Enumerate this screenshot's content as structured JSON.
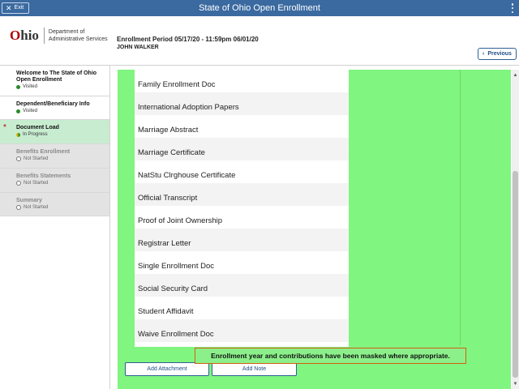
{
  "topbar": {
    "exit_label": "Exit",
    "title": "State of Ohio Open Enrollment"
  },
  "header": {
    "logo_word": "Ohio",
    "logo_dept_line1": "Department of",
    "logo_dept_line2": "Administrative Services",
    "period_text": "Enrollment Period 05/17/20   - 11:59pm 06/01/20",
    "person_name": "JOHN WALKER",
    "previous_label": "Previous"
  },
  "sidebar": {
    "steps": [
      {
        "name": "Welcome to The State of Ohio Open Enrollment",
        "status": "Visited",
        "state": "visited"
      },
      {
        "name": "Dependent/Beneficiary Info",
        "status": "Visited",
        "state": "visited"
      },
      {
        "name": "Document Load",
        "status": "In Progress",
        "state": "current"
      },
      {
        "name": "Benefits Enrollment",
        "status": "Not Started",
        "state": "not-started"
      },
      {
        "name": "Benefits Statements",
        "status": "Not Started",
        "state": "not-started"
      },
      {
        "name": "Summary",
        "status": "Not Started",
        "state": "not-started"
      }
    ]
  },
  "documents": [
    "Family Enrollment Doc",
    "International Adoption Papers",
    "Marriage Abstract",
    "Marriage Certificate",
    "NatStu Clrghouse Certificate",
    "Official Transcript",
    "Proof of Joint Ownership",
    "Registrar Letter",
    "Single Enrollment Doc",
    "Social Security Card",
    "Student Affidavit",
    "Waive Enrollment Doc"
  ],
  "actions": {
    "add_attachment_label": "Add Attachment",
    "add_note_label": "Add Note"
  },
  "notice": "Enrollment year and contributions have been masked where appropriate.",
  "colors": {
    "topbar": "#3a6aa0",
    "content_bg": "#80f57f",
    "current_step_bg": "#c8ecd0",
    "brand_red": "#b30000"
  }
}
